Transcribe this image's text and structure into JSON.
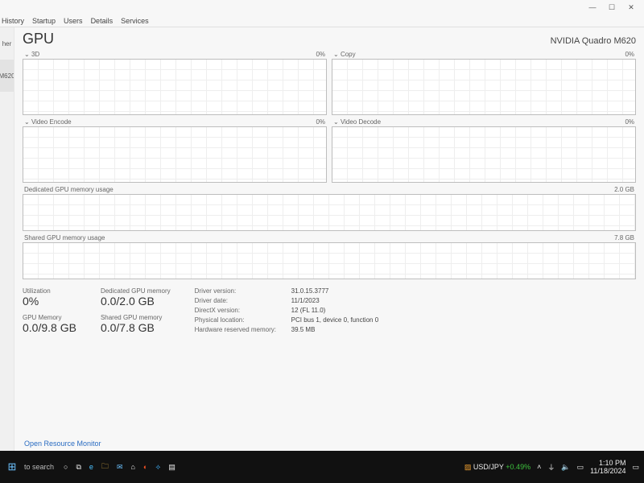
{
  "window": {
    "minimize": "—",
    "maximize": "☐",
    "close": "✕"
  },
  "tabs": {
    "history": "History",
    "startup": "Startup",
    "users": "Users",
    "details": "Details",
    "services": "Services"
  },
  "sidebar": {
    "item_other": "her",
    "item_selected": "M620"
  },
  "header": {
    "title": "GPU",
    "model": "NVIDIA Quadro M620"
  },
  "panes": {
    "p3d": {
      "title": "3D",
      "right": "0%",
      "dropdown": "⌄"
    },
    "copy": {
      "title": "Copy",
      "right": "0%",
      "dropdown": "⌄"
    },
    "venc": {
      "title": "Video Encode",
      "right": "0%",
      "dropdown": "⌄"
    },
    "vdec": {
      "title": "Video Decode",
      "right": "0%",
      "dropdown": "⌄"
    },
    "dedmem": {
      "title": "Dedicated GPU memory usage",
      "right": "2.0 GB"
    },
    "shmem": {
      "title": "Shared GPU memory usage",
      "right": "7.8 GB"
    }
  },
  "stats": {
    "utilization": {
      "label": "Utilization",
      "value": "0%"
    },
    "gpu_memory": {
      "label": "GPU Memory",
      "value": "0.0/9.8 GB"
    },
    "ded_mem": {
      "label": "Dedicated GPU memory",
      "value": "0.0/2.0 GB"
    },
    "sh_mem": {
      "label": "Shared GPU memory",
      "value": "0.0/7.8 GB"
    }
  },
  "driver": {
    "version": {
      "k": "Driver version:",
      "v": "31.0.15.3777"
    },
    "date": {
      "k": "Driver date:",
      "v": "11/1/2023"
    },
    "directx": {
      "k": "DirectX version:",
      "v": "12 (FL 11.0)"
    },
    "location": {
      "k": "Physical location:",
      "v": "PCI bus 1, device 0, function 0"
    },
    "reserved": {
      "k": "Hardware reserved memory:",
      "v": "39.5 MB"
    }
  },
  "footer": {
    "open_rm": "Open Resource Monitor"
  },
  "taskbar": {
    "start": "⊞",
    "search": "to search",
    "cortana": "○",
    "taskview": "⧉",
    "edge": "e",
    "explorer": "🗀",
    "mail": "✉",
    "store": "⌂",
    "chrome": "◐",
    "vscode": "⟡",
    "taskmgr": "▤",
    "stock_label": "USD/JPY",
    "stock_change": "+0.49%",
    "tray_up": "˄",
    "tray_wifi": "⏚",
    "tray_vol": "🔈",
    "tray_batt": "▭",
    "time": "1:10 PM",
    "date": "11/18/2024",
    "notif": "▭"
  },
  "chart_data": [
    {
      "type": "line",
      "title": "3D",
      "ylim": [
        0,
        100
      ],
      "x": [],
      "values": [],
      "ylabel": "%"
    },
    {
      "type": "line",
      "title": "Copy",
      "ylim": [
        0,
        100
      ],
      "x": [],
      "values": [],
      "ylabel": "%"
    },
    {
      "type": "line",
      "title": "Video Encode",
      "ylim": [
        0,
        100
      ],
      "x": [],
      "values": [],
      "ylabel": "%"
    },
    {
      "type": "line",
      "title": "Video Decode",
      "ylim": [
        0,
        100
      ],
      "x": [],
      "values": [],
      "ylabel": "%"
    },
    {
      "type": "line",
      "title": "Dedicated GPU memory usage",
      "ylim": [
        0,
        2.0
      ],
      "x": [],
      "values": [],
      "ylabel": "GB"
    },
    {
      "type": "line",
      "title": "Shared GPU memory usage",
      "ylim": [
        0,
        7.8
      ],
      "x": [],
      "values": [],
      "ylabel": "GB"
    }
  ]
}
